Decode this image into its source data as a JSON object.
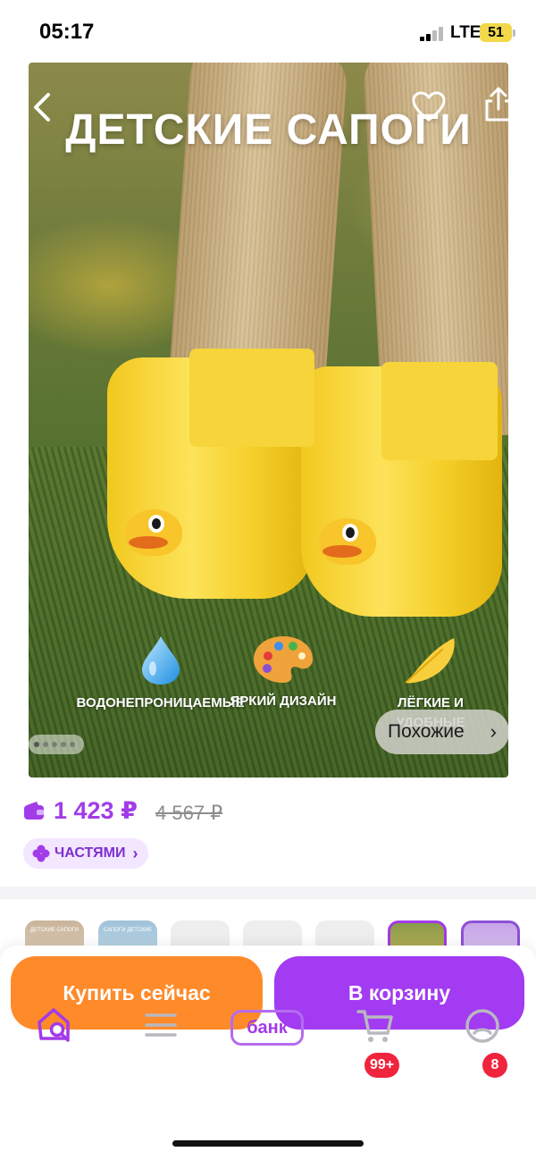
{
  "status_bar": {
    "time": "05:17",
    "network": "LTE",
    "battery": "51"
  },
  "gallery": {
    "title": "ДЕТСКИЕ САПОГИ",
    "features": [
      {
        "icon": "water-drop-icon",
        "label": "ВОДОНЕПРОНИЦАЕМЫЕ"
      },
      {
        "icon": "palette-icon",
        "label": "ЯРКИЙ ДИЗАЙН"
      },
      {
        "icon": "feather-icon",
        "label": "ЛЁГКИЕ И УДОБНЫЕ"
      }
    ],
    "similar_label": "Похожие",
    "page_count": 5,
    "current_page": 1
  },
  "product": {
    "price": "1 423 ₽",
    "old_price": "4 567 ₽",
    "installments_label": "ЧАСТЯМИ"
  },
  "thumbnails": [
    {
      "caption": "ДЕТСКИЕ САПОГИ"
    },
    {
      "caption": "САПОГИ ДЕТСКИЕ"
    },
    {
      "caption": ""
    },
    {
      "caption": ""
    },
    {
      "caption": ""
    },
    {
      "caption": ""
    },
    {
      "caption": ""
    }
  ],
  "actions": {
    "buy_now": "Купить сейчас",
    "add_to_cart": "В корзину"
  },
  "tab_bar": {
    "bank_label": "банк",
    "cart_badge": "99+",
    "profile_badge": "8"
  },
  "colors": {
    "accent": "#a23be8",
    "buy": "#ff8a2a",
    "cart": "#a23bf2",
    "badge": "#f0243d"
  }
}
